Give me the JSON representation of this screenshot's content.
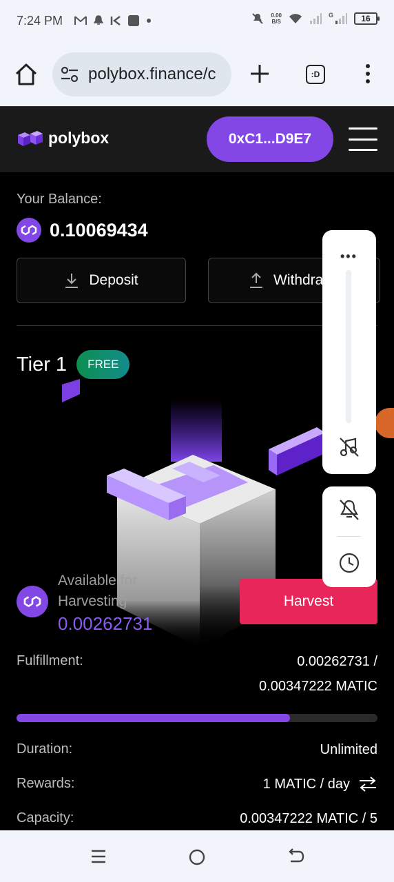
{
  "status_bar": {
    "time": "7:24 PM",
    "net_speed_value": "0.00",
    "net_speed_unit": "B/S",
    "signal_label": "G",
    "battery": "16"
  },
  "browser": {
    "url": "polybox.finance/c",
    "tab_label": ":D"
  },
  "header": {
    "logo_text": "polybox",
    "wallet_address": "0xC1...D9E7"
  },
  "balance": {
    "label": "Your Balance:",
    "value": "0.10069434"
  },
  "actions": {
    "deposit_label": "Deposit",
    "withdraw_label": "Withdra"
  },
  "tier": {
    "title": "Tier 1",
    "badge": "FREE"
  },
  "harvest": {
    "available_label": "Available for Harvesting",
    "available_value": "0.00262731",
    "button_label": "Harvest"
  },
  "stats": {
    "fulfillment_label": "Fulfillment:",
    "fulfillment_line1": "0.00262731 /",
    "fulfillment_line2": "0.00347222 MATIC",
    "progress_fraction": 0.757,
    "duration_label": "Duration:",
    "duration_value": "Unlimited",
    "rewards_label": "Rewards:",
    "rewards_value": "1 MATIC / day",
    "capacity_label": "Capacity:",
    "capacity_value": "0.00347222 MATIC / 5"
  },
  "colors": {
    "accent": "#8247e5",
    "harvest": "#e8265a"
  }
}
